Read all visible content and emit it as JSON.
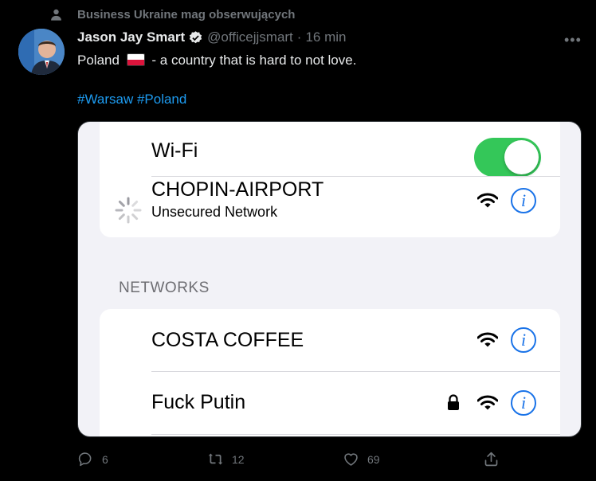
{
  "social_context": {
    "text": "Business Ukraine mag obserwujących"
  },
  "tweet": {
    "author_name": "Jason Jay Smart",
    "handle": "@officejjsmart",
    "separator": "·",
    "time": "16 min",
    "text_before_flag": "Poland",
    "text_after_flag": "- a country that is hard to not love.",
    "hashtags": [
      "#Warsaw",
      "#Poland"
    ]
  },
  "wifi_screen": {
    "wifi_label": "Wi-Fi",
    "wifi_enabled": true,
    "current_network": {
      "name": "CHOPIN-AIRPORT",
      "status": "Unsecured Network"
    },
    "section_header": "NETWORKS",
    "networks": [
      {
        "name": "COSTA COFFEE",
        "locked": false
      },
      {
        "name": "Fuck Putin",
        "locked": true
      }
    ],
    "toggle_color": "#34c759",
    "info_color": "#1a73e8"
  },
  "actions": {
    "replies": "6",
    "retweets": "12",
    "likes": "69"
  },
  "icons": [
    "person-icon",
    "verified-icon",
    "more-icon",
    "spinner-icon",
    "wifi-icon",
    "info-icon",
    "lock-icon",
    "reply-icon",
    "retweet-icon",
    "like-icon",
    "share-icon"
  ]
}
